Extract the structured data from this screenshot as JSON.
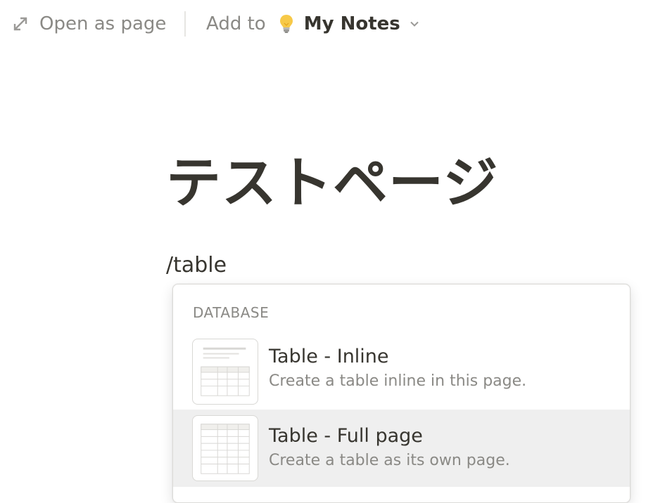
{
  "topbar": {
    "open_as_page": "Open as page",
    "add_to": "Add to",
    "workspace": "My Notes"
  },
  "page": {
    "title": "テストページ",
    "input_text": "/table"
  },
  "menu": {
    "section_label": "DATABASE",
    "items": [
      {
        "title": "Table - Inline",
        "description": "Create a table inline in this page.",
        "icon": "table-inline-icon",
        "selected": false
      },
      {
        "title": "Table - Full page",
        "description": "Create a table as its own page.",
        "icon": "table-full-page-icon",
        "selected": true
      }
    ]
  },
  "colors": {
    "text": "#37352f",
    "muted": "#8a8985",
    "selected_bg": "#efefef",
    "bulb": "#f7c948"
  }
}
